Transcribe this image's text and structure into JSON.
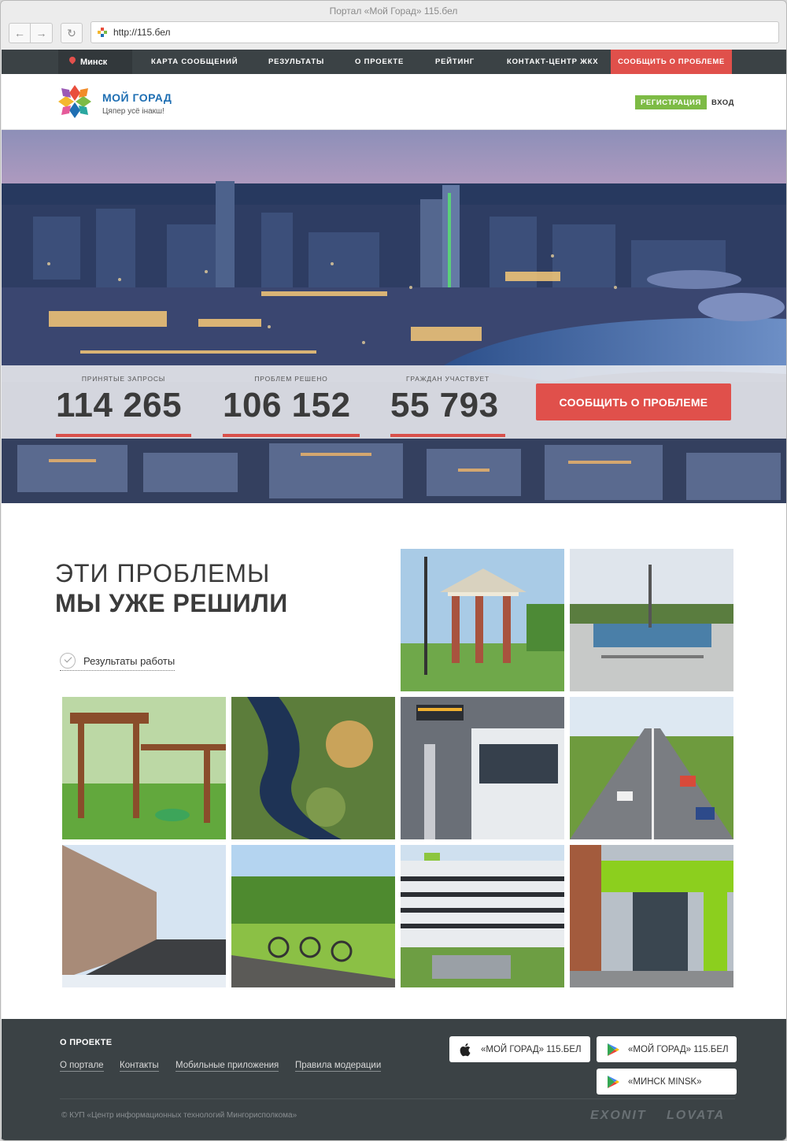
{
  "browser": {
    "window_title": "Портал «Мой Горад» 115.бел",
    "url": "http://115.бел"
  },
  "topnav": {
    "city": "Минск",
    "links": [
      "КАРТА СООБЩЕНИЙ",
      "РЕЗУЛЬТАТЫ",
      "О ПРОЕКТЕ",
      "РЕЙТИНГ",
      "КОНТАКТ-ЦЕНТР ЖКХ"
    ],
    "report_button": "СООБЩИТЬ О ПРОБЛЕМЕ"
  },
  "header": {
    "logo_title": "МОЙ ГОРАД",
    "logo_subtitle": "Цяпер усё інакш!",
    "register": "РЕГИСТРАЦИЯ",
    "login": "ВХОД"
  },
  "stats": [
    {
      "label": "ПРИНЯТЫЕ ЗАПРОСЫ",
      "value": "114 265"
    },
    {
      "label": "ПРОБЛЕМ РЕШЕНО",
      "value": "106 152"
    },
    {
      "label": "ГРАЖДАН УЧАСТВУЕТ",
      "value": "55 793"
    }
  ],
  "hero_cta": "СООБЩИТЬ О ПРОБЛЕМЕ",
  "solved": {
    "title_light": "ЭТИ ПРОБЛЕМЫ",
    "title_bold": "МЫ УЖЕ РЕШИЛИ",
    "results_link": "Результаты работы"
  },
  "footer": {
    "title": "О ПРОЕКТЕ",
    "links": [
      "О портале",
      "Контакты",
      "Мобильные приложения",
      "Правила модерации"
    ],
    "apps": [
      {
        "label": "«МОЙ ГОРАД» 115.БЕЛ",
        "icon": "apple-icon"
      },
      {
        "label": "«МОЙ ГОРАД» 115.БЕЛ",
        "icon": "google-play-icon"
      },
      {
        "label": "«МИНСК MINSK»",
        "icon": "google-play-icon"
      }
    ],
    "copyright": "© КУП «Центр информационных технологий Мингорисполкома»",
    "partners": [
      "EXONIT",
      "LOVATA"
    ]
  },
  "colors": {
    "accent_red": "#e0504b",
    "nav_dark": "#3b4245",
    "register_green": "#7dbb45",
    "logo_blue": "#1f6fb3"
  }
}
